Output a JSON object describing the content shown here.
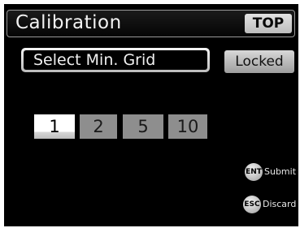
{
  "header": {
    "title": "Calibration",
    "top_button": "TOP"
  },
  "mode": {
    "label": "Select Min. Grid",
    "lock_status": "Locked"
  },
  "grid_options": [
    {
      "label": "1",
      "selected": true
    },
    {
      "label": "2",
      "selected": false
    },
    {
      "label": "5",
      "selected": false
    },
    {
      "label": "10",
      "selected": false
    }
  ],
  "hints": {
    "submit": {
      "key": "ENT",
      "label": "Submit"
    },
    "discard": {
      "key": "ESC",
      "label": "Discard"
    }
  }
}
